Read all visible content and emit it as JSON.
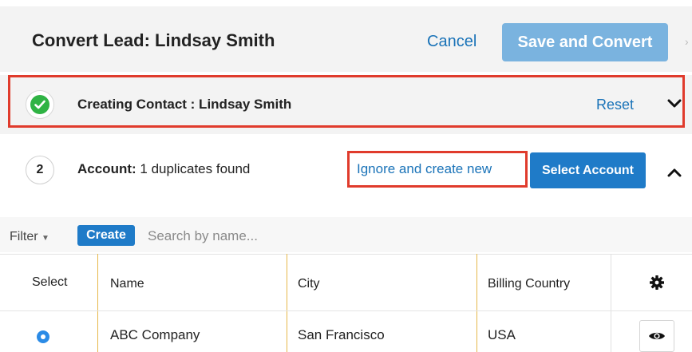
{
  "header": {
    "title": "Convert Lead: Lindsay Smith",
    "cancel_label": "Cancel",
    "save_label": "Save and Convert"
  },
  "step_contact": {
    "label": "Creating Contact : Lindsay Smith",
    "reset_label": "Reset",
    "status_icon": "check-icon",
    "toggle_icon": "chevron-down-icon"
  },
  "step_account": {
    "number": "2",
    "label_bold": "Account:",
    "label_rest": " 1 duplicates found",
    "ignore_label": "Ignore and create new",
    "select_label": "Select Account",
    "toggle_icon": "chevron-up-icon"
  },
  "filter_bar": {
    "filter_label": "Filter",
    "create_label": "Create",
    "search_placeholder": "Search by name..."
  },
  "table": {
    "columns": [
      "Select",
      "Name",
      "City",
      "Billing Country"
    ],
    "rows": [
      {
        "name": "ABC Company",
        "city": "San Francisco",
        "country": "USA",
        "selected": true
      }
    ]
  },
  "colors": {
    "accent": "#1f7bc8",
    "save_button": "#7ab3df",
    "highlight_border": "#e03b2c",
    "success": "#2fb344",
    "column_divider": "#e6b84a"
  }
}
